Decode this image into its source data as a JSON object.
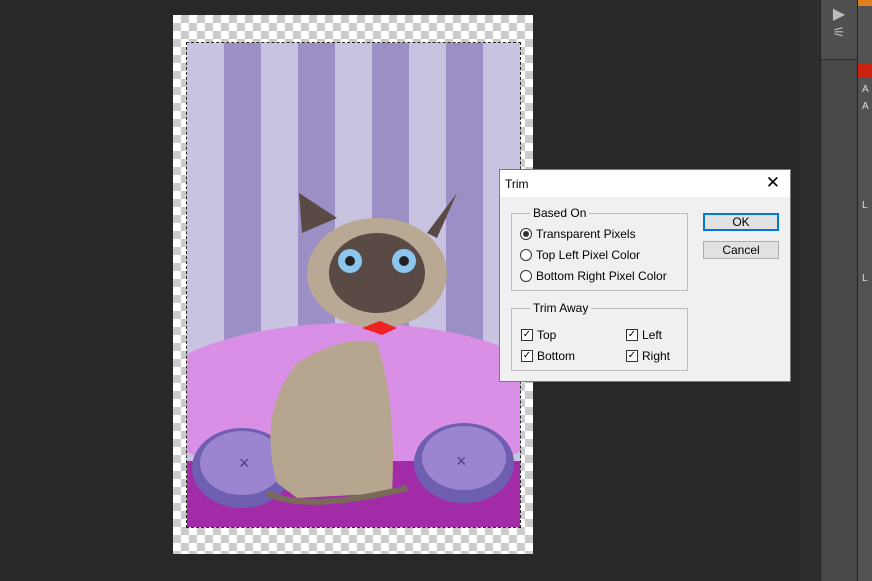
{
  "dialog": {
    "title": "Trim",
    "close_icon": "close-icon",
    "based_on": {
      "legend": "Based On",
      "options": [
        {
          "label": "Transparent Pixels",
          "selected": true
        },
        {
          "label": "Top Left Pixel Color",
          "selected": false
        },
        {
          "label": "Bottom Right Pixel Color",
          "selected": false
        }
      ]
    },
    "trim_away": {
      "legend": "Trim Away",
      "top": "Top",
      "bottom": "Bottom",
      "left": "Left",
      "right": "Right"
    },
    "ok": "OK",
    "cancel": "Cancel"
  },
  "panel": {
    "labels": [
      "A",
      "A",
      "L",
      "L"
    ]
  }
}
